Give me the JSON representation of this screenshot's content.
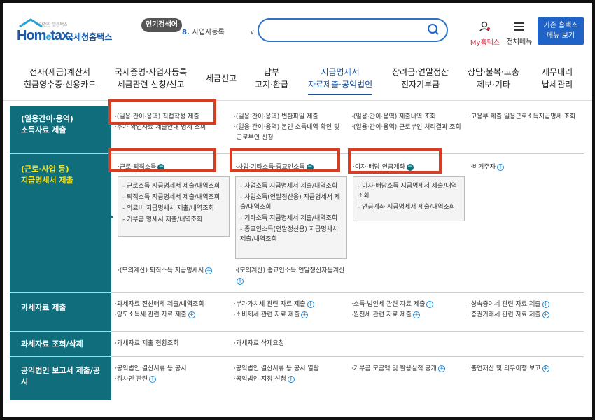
{
  "header": {
    "logo_brand": "Hom",
    "logo_e": "e",
    "logo_brand_tail": "tax.",
    "logo_ko": "국세청홈택스",
    "logo_tagline": "안전한 일등택스",
    "popular_badge": "인기검색어",
    "popular_num": "8.",
    "popular_term": "사업자등록",
    "search_placeholder": "",
    "myhome_label": "My홈택스",
    "allmenu_label": "전체메뉴",
    "old_home_label_1": "기존 홈택스",
    "old_home_label_2": "메뉴 보기"
  },
  "nav": [
    {
      "line1": "전자(세금)계산서",
      "line2": "현금영수증·신용카드"
    },
    {
      "line1": "국세증명·사업자등록",
      "line2": "세금관련 신청/신고"
    },
    {
      "line1": "세금신고",
      "line2": ""
    },
    {
      "line1": "납부",
      "line2": "고지·환급"
    },
    {
      "line1": "지급명세서",
      "line2": "자료제출·공익법인"
    },
    {
      "line1": "장려금·연말정산",
      "line2": "전자기부금"
    },
    {
      "line1": "상담·불복·고충",
      "line2": "제보·기타"
    },
    {
      "line1": "세무대리",
      "line2": "납세관리"
    }
  ],
  "rows": {
    "r1": {
      "head_1": "(일용간이·용역)",
      "head_2": "소득자료 제출",
      "c1": [
        "·(일용·간이·용역) 직접작성 제출",
        "·추가 확인자료 제출안내 명세 조회"
      ],
      "c2": [
        "·(일용·간이·용역) 변환파일 제출",
        "·(일용·간이·용역) 본인 소득내역 확인 및",
        "근로부인 신청"
      ],
      "c3": [
        "·(일용·간이·용역) 제출내역 조회",
        "·(일용·간이·용역) 근로부인 처리결과 조회"
      ],
      "c4": [
        "·고용부 제출 일용근로소득지급명세 조회"
      ]
    },
    "r2": {
      "head_1": "(근로·사업 등)",
      "head_2": "지급명세서 제출",
      "c1_title": "·근로·퇴직소득",
      "c1_sub": [
        "- 근로소득 지급명세서 제출/내역조회",
        "- 퇴직소득 지급명세서 제출/내역조회",
        "- 의료비 지급명세서 제출/내역조회",
        "- 기부금 명세서 제출/내역조회"
      ],
      "c2_title": "·사업·기타소득·종교인소득",
      "c2_sub": [
        "- 사업소득 지급명세서 제출/내역조회",
        "- 사업소득(연말정산용) 지급명세서 제",
        "출/내역조회",
        "- 기타소득 지급명세서 제출/내역조회",
        "- 종교인소득(연말정산용) 지급명세서",
        "제출/내역조회"
      ],
      "c3_title": "·이자·배당·연금계좌",
      "c3_sub": [
        "- 이자·배당소득 지급명세서 제출/내역",
        "조회",
        "- 연금계좌 지급명세서 제출/내역조회"
      ],
      "c4_title": "·비거주자",
      "c1_bottom": "·(모의계산) 퇴직소득 지급명세서",
      "c2_bottom": "·(모의계산) 종교인소득 연말정산자동계산"
    },
    "r3": {
      "head_1": "과세자료 제출",
      "c1": [
        "·과세자료 전산매체 제출/내역조회",
        "·양도소득세 관련 자료 제출"
      ],
      "c2": [
        "·부가가치세 관련 자료 제출",
        "·소비제세 관련 자료 제출"
      ],
      "c3": [
        "·소득·법인세 관련 자료 제출",
        "·원천세 관련 자료 제출"
      ],
      "c4": [
        "·상속증여세 관련 자료 제출",
        "·증권거래세 관련 자료 제출"
      ]
    },
    "r4": {
      "head_1": "과세자료 조회/삭제",
      "c1": [
        "·과세자료 제출 현황조회"
      ],
      "c2": [
        "·과세자료 삭제요청"
      ]
    },
    "r5": {
      "head_1": "공익법인 보고서 제출/공시",
      "c1": [
        "·공익법인 결산서류 등 공시",
        "·감사인 관련"
      ],
      "c2": [
        "·공익법인 결산서류 등 공시 열람",
        "·공익법인 지정 신청"
      ],
      "c3": [
        "·기부금 모금액 및 활용실적 공개"
      ],
      "c4": [
        "·출연재산 및 의무이행 보고"
      ]
    }
  },
  "colors": {
    "teal": "#0f6d7c",
    "brand_blue": "#1d5aa8",
    "highlight_red": "#d73c24",
    "accent_yellow": "#f7e21c"
  }
}
